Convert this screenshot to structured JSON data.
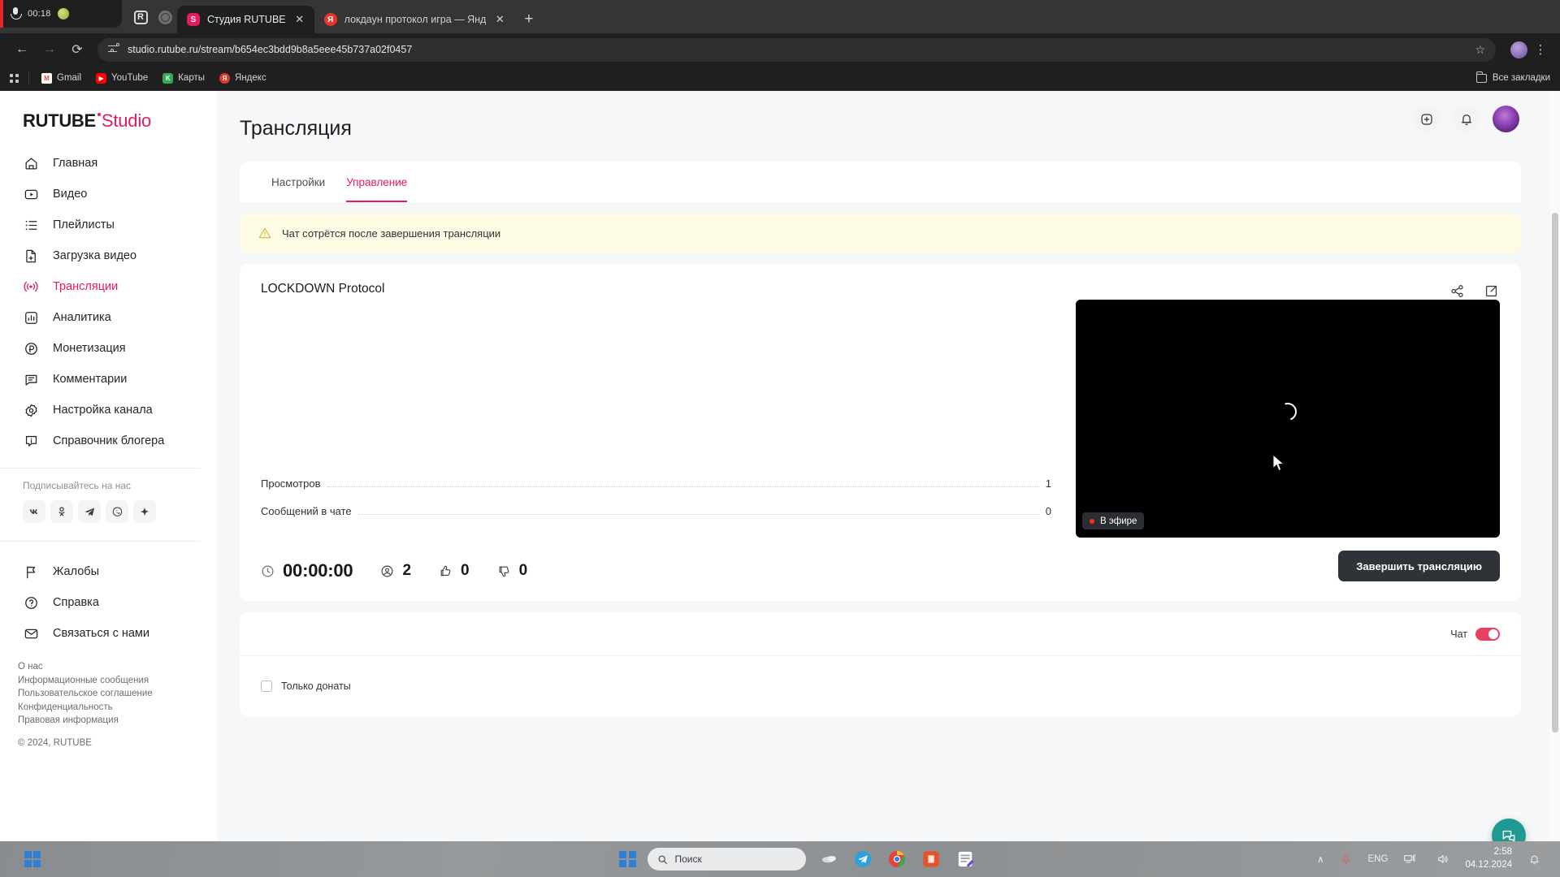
{
  "browser": {
    "recorder": {
      "time": "00:18"
    },
    "tabs": [
      {
        "title": "Студия RUTUBE",
        "favicon": "rutube-favicon",
        "active": true,
        "close_label": "✕"
      },
      {
        "title": "локдаун протокол игра — Янд",
        "favicon": "yandex-favicon",
        "active": false,
        "close_label": "✕"
      }
    ],
    "new_tab_label": "+",
    "nav": {
      "back": "←",
      "forward": "→",
      "reload": "⟳"
    },
    "omnibox": {
      "url": "studio.rutube.ru/stream/b654ec3bdd9b8a5eee45b737a02f0457",
      "star": "☆"
    },
    "menu_label": "⋮",
    "bookmarks": [
      {
        "label": "Gmail",
        "icon": "gmail-icon"
      },
      {
        "label": "YouTube",
        "icon": "youtube-icon"
      },
      {
        "label": "Карты",
        "icon": "maps-icon"
      },
      {
        "label": "Яндекс",
        "icon": "yandex-icon"
      }
    ],
    "bookmarks_all": "Все закладки"
  },
  "sidebar": {
    "logo": {
      "rutube": "RUTUBE",
      "studio": "Studio"
    },
    "items": [
      {
        "label": "Главная",
        "icon": "home-icon",
        "active": false
      },
      {
        "label": "Видео",
        "icon": "video-icon",
        "active": false
      },
      {
        "label": "Плейлисты",
        "icon": "playlist-icon",
        "active": false
      },
      {
        "label": "Загрузка видео",
        "icon": "upload-icon",
        "active": false
      },
      {
        "label": "Трансляции",
        "icon": "broadcast-icon",
        "active": true
      },
      {
        "label": "Аналитика",
        "icon": "analytics-icon",
        "active": false
      },
      {
        "label": "Монетизация",
        "icon": "monetization-icon",
        "active": false
      },
      {
        "label": "Комментарии",
        "icon": "comments-icon",
        "active": false
      },
      {
        "label": "Настройка канала",
        "icon": "gear-icon",
        "active": false
      },
      {
        "label": "Справочник блогера",
        "icon": "info-icon",
        "active": false
      }
    ],
    "subscribe_title": "Подписывайтесь на нас",
    "socials": [
      {
        "name": "vk-icon"
      },
      {
        "name": "ok-icon"
      },
      {
        "name": "telegram-icon"
      },
      {
        "name": "viber-icon"
      },
      {
        "name": "plus-icon"
      }
    ],
    "bottom_items": [
      {
        "label": "Жалобы",
        "icon": "flag-icon"
      },
      {
        "label": "Справка",
        "icon": "help-icon"
      },
      {
        "label": "Связаться с нами",
        "icon": "mail-icon"
      }
    ],
    "footer_links": [
      "О нас",
      "Информационные сообщения",
      "Пользовательское соглашение",
      "Конфиденциальность",
      "Правовая информация"
    ],
    "copyright": "© 2024, RUTUBE"
  },
  "header": {
    "add_icon": "add-video-icon",
    "bell_icon": "bell-icon",
    "avatar": "user-avatar"
  },
  "main": {
    "page_title": "Трансляция",
    "tabs": [
      {
        "label": "Настройки",
        "active": false
      },
      {
        "label": "Управление",
        "active": true
      }
    ],
    "warning": {
      "icon": "warning-icon",
      "text": "Чат сотрётся после завершения трансляции"
    },
    "stream": {
      "title": "LOCKDOWN Protocol",
      "share_icon": "share-icon",
      "open_icon": "open-external-icon",
      "stats": [
        {
          "label": "Просмотров",
          "value": "1"
        },
        {
          "label": "Сообщений в чате",
          "value": "0"
        }
      ],
      "metrics": [
        {
          "icon": "clock-icon",
          "value": "00:00:00",
          "name": "duration"
        },
        {
          "icon": "viewers-icon",
          "value": "2",
          "name": "viewers"
        },
        {
          "icon": "like-icon",
          "value": "0",
          "name": "likes"
        },
        {
          "icon": "dislike-icon",
          "value": "0",
          "name": "dislikes"
        }
      ],
      "player": {
        "live_badge": "В эфире",
        "state": "loading"
      },
      "end_button": "Завершить трансляцию"
    },
    "chat": {
      "toggle_label": "Чат",
      "toggle_on": true,
      "donates_only_label": "Только донаты",
      "donates_only_checked": false
    },
    "fab_icon": "chat-support-icon"
  },
  "colors": {
    "accent": "#e51b5c",
    "warning_bg": "#fdfbe4",
    "page_bg": "#f6f7f9",
    "dark_button": "#2f3338",
    "fab": "#1f9a92",
    "live_red": "#ff2b2b"
  },
  "taskbar": {
    "start_icon": "windows-start-icon",
    "search_placeholder": "Поиск",
    "apps": [
      {
        "name": "telegram-taskbar-icon"
      },
      {
        "name": "chrome-taskbar-icon"
      },
      {
        "name": "obs-taskbar-icon"
      },
      {
        "name": "editor-taskbar-icon"
      }
    ],
    "tray": {
      "chevron": "∧",
      "mic": "mic-icon",
      "language": "ENG",
      "network": "network-icon",
      "volume": "volume-icon",
      "time": "2:58",
      "date": "04.12.2024",
      "notification": "bell-icon"
    }
  }
}
